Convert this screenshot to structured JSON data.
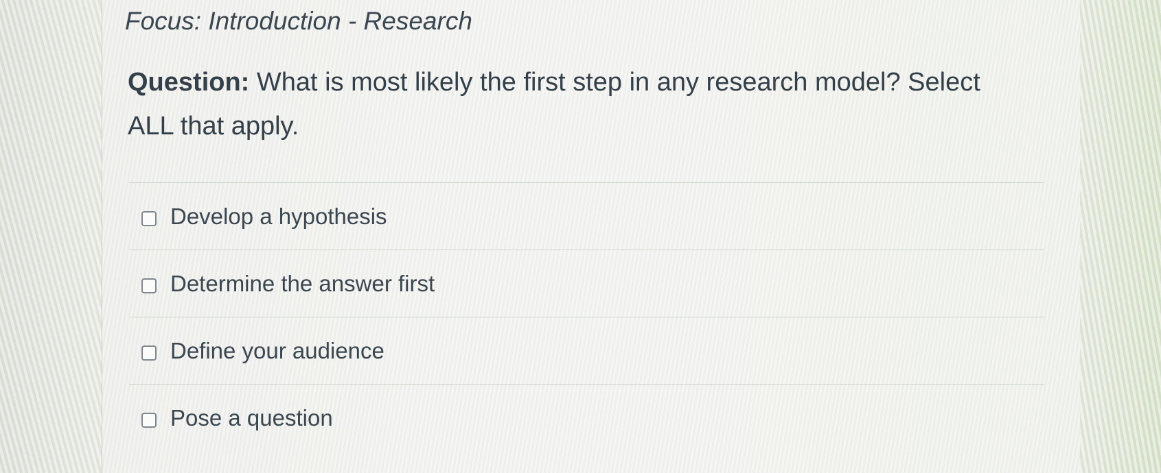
{
  "quiz": {
    "focus_title": "Focus: Introduction - Research",
    "question_label": "Question:",
    "question_text": "What is most likely the first step in any research model? Select ALL that apply.",
    "answers": [
      {
        "label": "Develop a hypothesis",
        "checked": false
      },
      {
        "label": "Determine the answer first",
        "checked": false
      },
      {
        "label": "Define your audience",
        "checked": false
      },
      {
        "label": "Pose a question",
        "checked": false
      }
    ]
  }
}
